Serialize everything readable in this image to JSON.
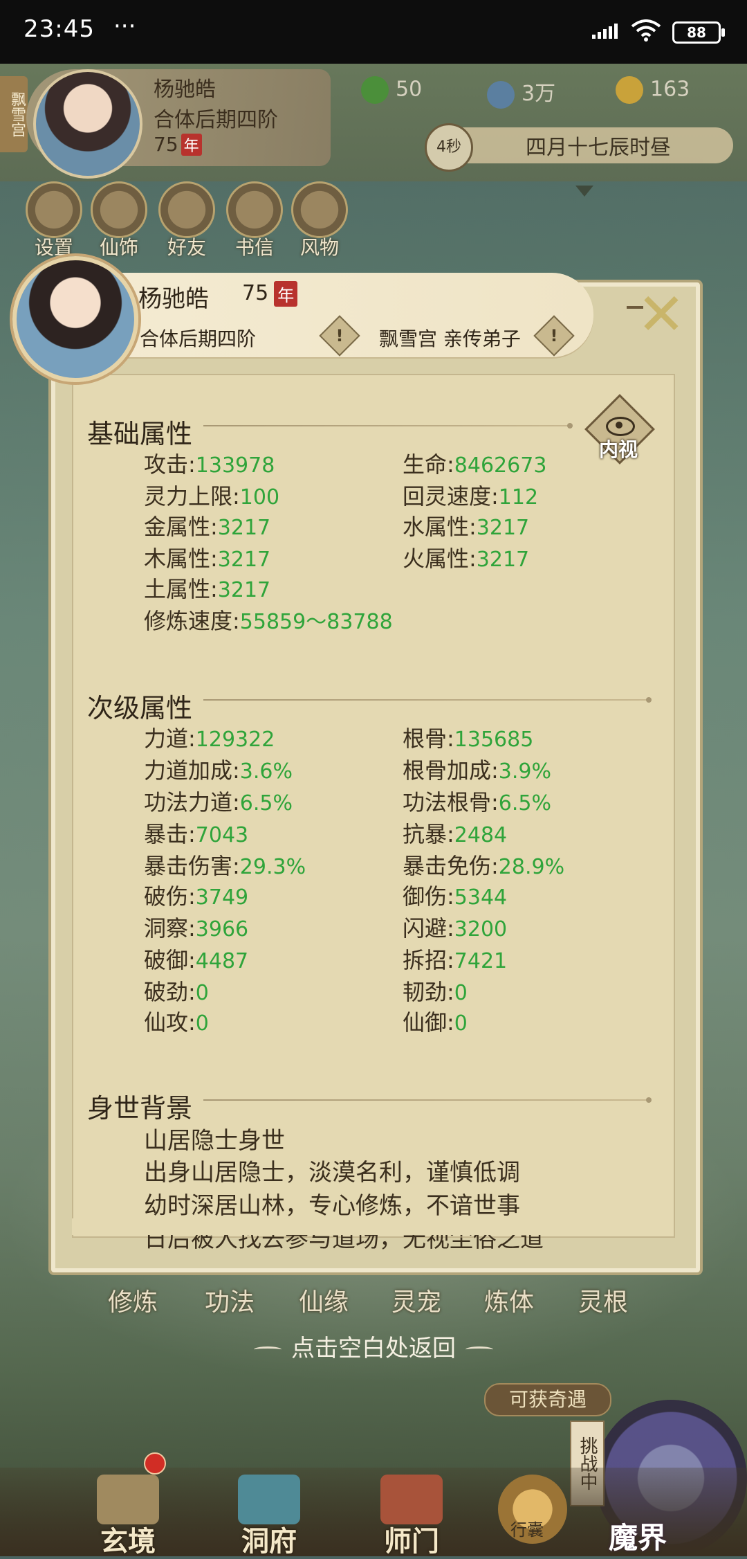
{
  "status_bar": {
    "time": "23:45",
    "dots": "···",
    "battery": "88"
  },
  "header": {
    "sect_tag": "飘雪宫",
    "player_name": "杨驰皓",
    "realm": "合体后期四阶",
    "age": "75",
    "age_unit": "年",
    "resources": [
      {
        "name": "leaf-currency",
        "value": "50",
        "color": "#4b8f3a"
      },
      {
        "name": "coin-currency",
        "value": "3万",
        "color": "#5b7fa0"
      },
      {
        "name": "gold-currency",
        "value": "163",
        "color": "#c9a23a"
      }
    ],
    "timer_seconds": "4秒",
    "game_time": "四月十七辰时昼",
    "shortcuts": [
      "设置",
      "仙饰",
      "好友",
      "书信",
      "风物"
    ]
  },
  "dialog": {
    "name": "杨驰皓",
    "age": "75",
    "age_unit": "年",
    "realm": "合体后期四阶",
    "sect": "飘雪宫 亲传弟子",
    "info_mark": "!",
    "close_symbol": "✕",
    "inner_view_label": "内视",
    "basic": {
      "title": "基础属性",
      "left": [
        {
          "label": "攻击",
          "value": "133978"
        },
        {
          "label": "灵力上限",
          "value": "100"
        },
        {
          "label": "金属性",
          "value": "3217"
        },
        {
          "label": "木属性",
          "value": "3217"
        },
        {
          "label": "土属性",
          "value": "3217"
        },
        {
          "label": "修炼速度",
          "value": "55859～83788"
        }
      ],
      "right": [
        {
          "label": "生命",
          "value": "8462673"
        },
        {
          "label": "回灵速度",
          "value": "112"
        },
        {
          "label": "水属性",
          "value": "3217"
        },
        {
          "label": "火属性",
          "value": "3217"
        }
      ]
    },
    "secondary": {
      "title": "次级属性",
      "left": [
        {
          "label": "力道",
          "value": "129322"
        },
        {
          "label": "力道加成",
          "value": "3.6%"
        },
        {
          "label": "功法力道",
          "value": "6.5%"
        },
        {
          "label": "暴击",
          "value": "7043"
        },
        {
          "label": "暴击伤害",
          "value": "29.3%"
        },
        {
          "label": "破伤",
          "value": "3749"
        },
        {
          "label": "洞察",
          "value": "3966"
        },
        {
          "label": "破御",
          "value": "4487"
        },
        {
          "label": "破劲",
          "value": "0"
        },
        {
          "label": "仙攻",
          "value": "0"
        }
      ],
      "right": [
        {
          "label": "根骨",
          "value": "135685"
        },
        {
          "label": "根骨加成",
          "value": "3.9%"
        },
        {
          "label": "功法根骨",
          "value": "6.5%"
        },
        {
          "label": "抗暴",
          "value": "2484"
        },
        {
          "label": "暴击免伤",
          "value": "28.9%"
        },
        {
          "label": "御伤",
          "value": "5344"
        },
        {
          "label": "闪避",
          "value": "3200"
        },
        {
          "label": "拆招",
          "value": "7421"
        },
        {
          "label": "韧劲",
          "value": "0"
        },
        {
          "label": "仙御",
          "value": "0"
        }
      ]
    },
    "background": {
      "title": "身世背景",
      "lines": [
        "山居隐士身世",
        "出身山居隐士，淡漠名利，谨慎低调",
        "幼时深居山林，专心修炼，不谙世事",
        "日后被人找去参与道场，无视尘俗之道"
      ]
    }
  },
  "lower": {
    "tabs": [
      "修炼",
      "功法",
      "仙缘",
      "灵宠",
      "炼体",
      "灵根"
    ],
    "return_hint": "点击空白处返回",
    "adventure_button": "可获奇遇",
    "challenge_label": "挑战中"
  },
  "bottom_nav": {
    "items": [
      "玄境",
      "洞府",
      "师门"
    ],
    "bag_label": "行囊",
    "demon_realm": "魔界"
  }
}
